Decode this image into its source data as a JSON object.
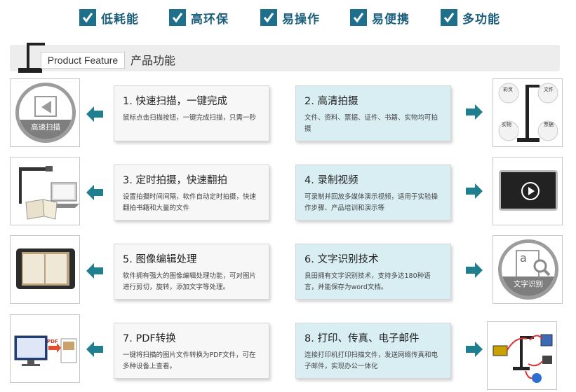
{
  "top_features": [
    "低耗能",
    "高环保",
    "易操作",
    "易便携",
    "多功能"
  ],
  "header": {
    "tag": "Product Feature",
    "title": "产品功能"
  },
  "cards": [
    {
      "title": "1. 快速扫描，一键完成",
      "desc": "鼠标点击扫描按钮，一键完成扫描，只需一秒"
    },
    {
      "title": "2. 高清拍摄",
      "desc": "文件、资料、票据、证件、书籍、实物均可拍摄"
    },
    {
      "title": "3. 定时拍摄，快速翻拍",
      "desc": "设置拍摄时间间隔，软件自动定时拍摄，快速翻拍书籍和大量的文件"
    },
    {
      "title": "4. 录制视频",
      "desc": "可录制并回放多媒体演示视频，适用于实验操作步骤、产品培训和演示等"
    },
    {
      "title": "5. 图像编辑处理",
      "desc": "软件拥有强大的图像编辑处理功能，可对图片进行剪切，旋转，添加文字等处理。"
    },
    {
      "title": "6. 文字识别技术",
      "desc": "良田拥有文字识别技术，支持多达180种语言，并能保存为word文档。"
    },
    {
      "title": "7. PDF转换",
      "desc": "一键将扫描的图片文件转换为PDF文件，可在多种设备上查看。"
    },
    {
      "title": "8. 打印、传真、电子邮件",
      "desc": "连接打印机打印扫描文件，发送网络传真和电子邮件，实现办公一体化"
    }
  ],
  "images": {
    "scan_label": "高速扫描",
    "ocr_label": "文字识别",
    "ocr_glyph": "a",
    "pdf_label": "PDF",
    "objects": [
      "彩页",
      "文件",
      "实物",
      "票据"
    ]
  },
  "colors": {
    "accent": "#1d6f8c",
    "arrow": "#1f7f8f",
    "card_blue": "#d8eef3"
  }
}
